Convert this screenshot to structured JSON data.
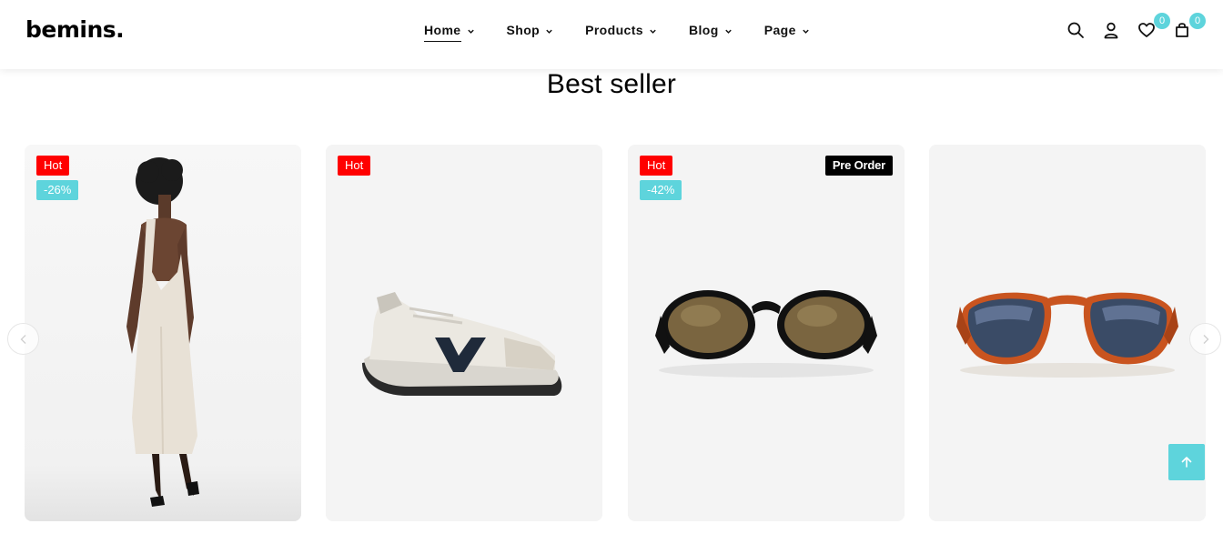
{
  "brand": {
    "logo": "bemins."
  },
  "nav": {
    "items": [
      {
        "label": "Home",
        "active": true
      },
      {
        "label": "Shop"
      },
      {
        "label": "Products"
      },
      {
        "label": "Blog"
      },
      {
        "label": "Page"
      }
    ]
  },
  "header_icons": {
    "search": "search-icon",
    "account": "user-icon",
    "wishlist": {
      "icon": "heart-icon",
      "count": "0"
    },
    "cart": {
      "icon": "bag-icon",
      "count": "0"
    }
  },
  "section": {
    "title": "Best seller"
  },
  "products": [
    {
      "image": "woman-in-cream-backless-dress",
      "badges": {
        "hot": "Hot",
        "sale": "-26%"
      }
    },
    {
      "image": "grey-sneaker",
      "badges": {
        "hot": "Hot"
      }
    },
    {
      "image": "black-round-sunglasses",
      "badges": {
        "hot": "Hot",
        "sale": "-42%",
        "pre_order": "Pre Order"
      }
    },
    {
      "image": "tortoise-aviator-sunglasses",
      "badges": {}
    }
  ],
  "colors": {
    "accent": "#5ed4dc",
    "hot": "#ff0000",
    "card_bg": "#f4f4f4"
  }
}
